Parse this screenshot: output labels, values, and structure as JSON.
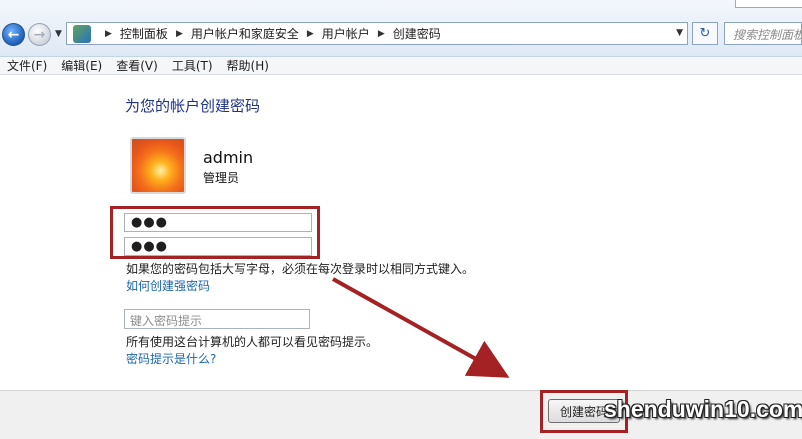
{
  "address_bar": {
    "breadcrumb": [
      "控制面板",
      "用户帐户和家庭安全",
      "用户帐户",
      "创建密码"
    ],
    "search_placeholder": "搜索控制面板"
  },
  "menu": [
    {
      "label": "文件(F)"
    },
    {
      "label": "编辑(E)"
    },
    {
      "label": "查看(V)"
    },
    {
      "label": "工具(T)"
    },
    {
      "label": "帮助(H)"
    }
  ],
  "page": {
    "title": "为您的帐户创建密码",
    "user": {
      "name": "admin",
      "role": "管理员"
    },
    "password_value": "●●●",
    "confirm_value": "●●●",
    "case_note": "如果您的密码包括大写字母，必须在每次登录时以相同方式键入。",
    "strong_password_link": "如何创建强密码",
    "hint_placeholder": "键入密码提示",
    "hint_note": "所有使用这台计算机的人都可以看见密码提示。",
    "hint_link": "密码提示是什么?"
  },
  "footer": {
    "create_button": "创建密码"
  },
  "watermark": "shenduwin10.com",
  "colors": {
    "highlight": "#a52224",
    "link": "#1d67ad",
    "title": "#1e3287"
  }
}
